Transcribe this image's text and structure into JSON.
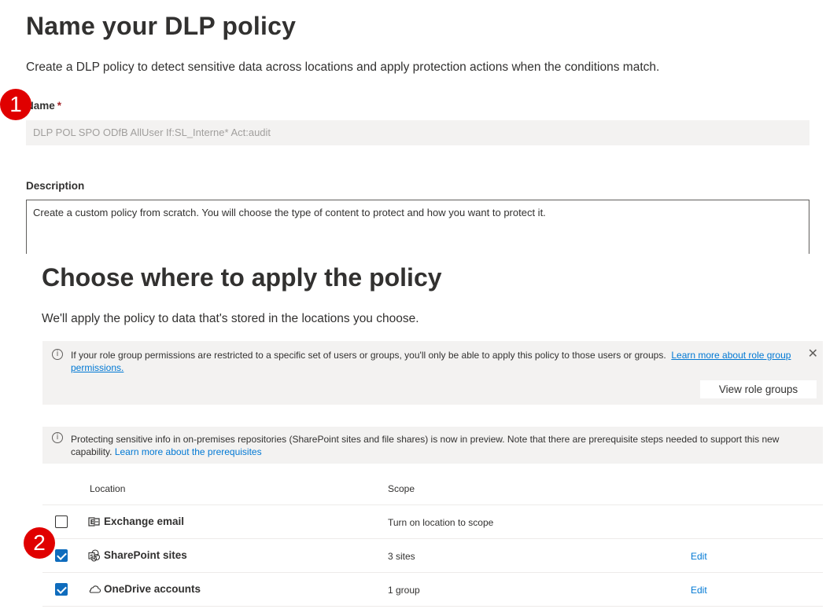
{
  "name_step": {
    "title": "Name your DLP policy",
    "intro": "Create a DLP policy to detect sensitive data across locations and apply protection actions when the conditions match.",
    "badge": "1",
    "name_label": "Name",
    "required_mark": "*",
    "name_value": "DLP POL SPO ODfB AllUser If:SL_Interne* Act:audit",
    "description_label": "Description",
    "description_value": "Create a custom policy from scratch. You will choose the type of content to protect and how you want to protect it."
  },
  "locations_step": {
    "title": "Choose where to apply the policy",
    "intro": "We'll apply the policy to data that's stored in the locations you choose.",
    "badge": "2",
    "role_notice": {
      "text": "If your role group permissions are restricted to a specific set of users or groups, you'll only be able to apply this policy to those users or groups.",
      "link": "Learn more about role group permissions.",
      "button": "View role groups",
      "close_glyph": "✕"
    },
    "preview_notice": {
      "text": "Protecting sensitive info in on-premises repositories (SharePoint sites and file shares) is now in preview. Note that there are prerequisite steps needed to support this new capability.",
      "link": "Learn more about the prerequisites"
    },
    "table": {
      "headers": {
        "location": "Location",
        "scope": "Scope"
      },
      "rows": [
        {
          "name": "Exchange email",
          "scope": "Turn on location to scope",
          "checked": false,
          "edit": ""
        },
        {
          "name": "SharePoint sites",
          "scope": "3 sites",
          "checked": true,
          "edit": "Edit"
        },
        {
          "name": "OneDrive accounts",
          "scope": "1 group",
          "checked": true,
          "edit": "Edit"
        }
      ]
    }
  },
  "colors": {
    "badge": "#e00000",
    "accent": "#0f6cbd",
    "link": "#0078d4",
    "notice_bg": "#f3f2f1"
  },
  "icons": {
    "info": "info-icon",
    "exchange": "exchange-icon",
    "sharepoint": "sharepoint-icon",
    "onedrive": "onedrive-cloud-icon",
    "close": "close-icon"
  }
}
